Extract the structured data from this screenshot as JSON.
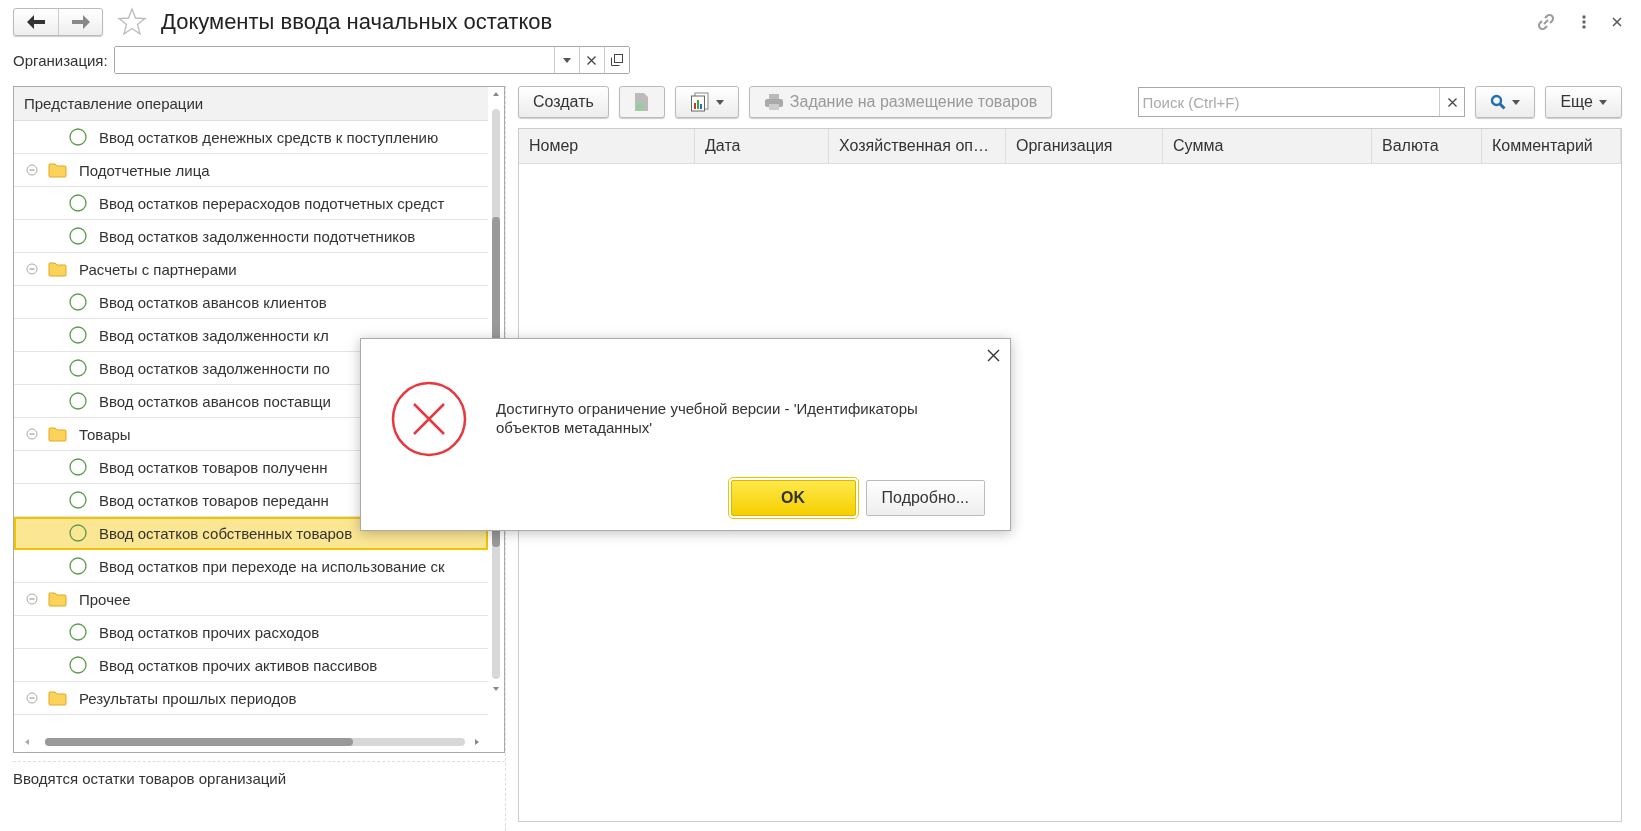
{
  "window": {
    "title": "Документы ввода начальных остатков",
    "favorite": false
  },
  "filter": {
    "label": "Организация:"
  },
  "tree": {
    "header": "Представление операции",
    "items": [
      {
        "kind": "item",
        "label": "Ввод остатков денежных средств к поступлению",
        "selected": false
      },
      {
        "kind": "group",
        "label": "Подотчетные лица",
        "expanded": true,
        "selected": false
      },
      {
        "kind": "item",
        "label": "Ввод остатков перерасходов подотчетных средст",
        "selected": false
      },
      {
        "kind": "item",
        "label": "Ввод остатков задолженности подотчетников",
        "selected": false
      },
      {
        "kind": "group",
        "label": "Расчеты с партнерами",
        "expanded": true,
        "selected": false
      },
      {
        "kind": "item",
        "label": "Ввод остатков авансов клиентов",
        "selected": false
      },
      {
        "kind": "item",
        "label": "Ввод остатков задолженности кл",
        "selected": false
      },
      {
        "kind": "item",
        "label": "Ввод остатков задолженности по",
        "selected": false
      },
      {
        "kind": "item",
        "label": "Ввод остатков авансов поставщи",
        "selected": false
      },
      {
        "kind": "group",
        "label": "Товары",
        "expanded": true,
        "selected": false
      },
      {
        "kind": "item",
        "label": "Ввод остатков товаров полученн",
        "selected": false
      },
      {
        "kind": "item",
        "label": "Ввод остатков товаров переданн",
        "selected": false
      },
      {
        "kind": "item",
        "label": "Ввод остатков собственных товаров",
        "selected": true
      },
      {
        "kind": "item",
        "label": "Ввод остатков при переходе на использование ск",
        "selected": false
      },
      {
        "kind": "group",
        "label": "Прочее",
        "expanded": true,
        "selected": false
      },
      {
        "kind": "item",
        "label": "Ввод остатков прочих расходов",
        "selected": false
      },
      {
        "kind": "item",
        "label": "Ввод остатков прочих активов пассивов",
        "selected": false
      },
      {
        "kind": "group",
        "label": "Результаты прошлых периодов",
        "expanded": true,
        "selected": false
      }
    ]
  },
  "description": "Вводятся остатки товаров организаций",
  "toolbar": {
    "create": "Создать",
    "print": "Задание на размещение товаров",
    "search": {
      "placeholder": "Поиск (Ctrl+F)"
    },
    "more": "Еще"
  },
  "table": {
    "columns": [
      "Номер",
      "Дата",
      "Хозяйственная оп…",
      "Организация",
      "Сумма",
      "Валюта",
      "Комментарий"
    ]
  },
  "dialog": {
    "message": "Достигнуто ограничение учебной версии - 'Идентификаторы объектов метаданных'",
    "buttons": [
      {
        "label": "OK",
        "default": true
      },
      {
        "label": "Подробно...",
        "default": false
      }
    ]
  }
}
